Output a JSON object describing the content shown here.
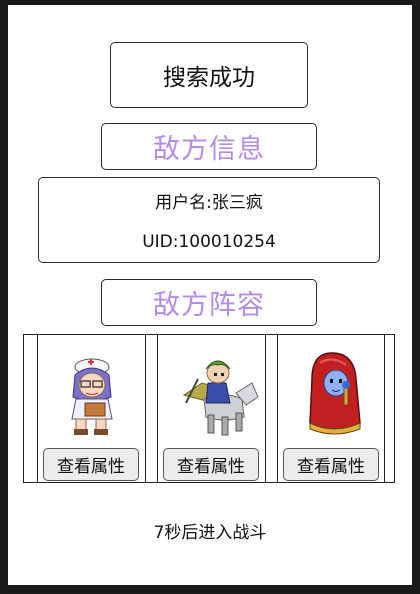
{
  "header": {
    "title": "搜索成功"
  },
  "enemy_info": {
    "section_title": "敌方信息",
    "username": "用户名:张三疯",
    "uid": "UID:100010254"
  },
  "lineup": {
    "section_title": "敌方阵容",
    "heroes": [
      {
        "icon": "nurse-hero-icon",
        "button_label": "查看属性"
      },
      {
        "icon": "knight-rider-hero-icon",
        "button_label": "查看属性"
      },
      {
        "icon": "red-hooded-mage-hero-icon",
        "button_label": "查看属性"
      }
    ]
  },
  "status": {
    "countdown": "7秒后进入战斗"
  },
  "colors": {
    "section_title": "#b58be6",
    "page_bg": "#ffffff",
    "frame_bg": "#1a1a1a"
  }
}
